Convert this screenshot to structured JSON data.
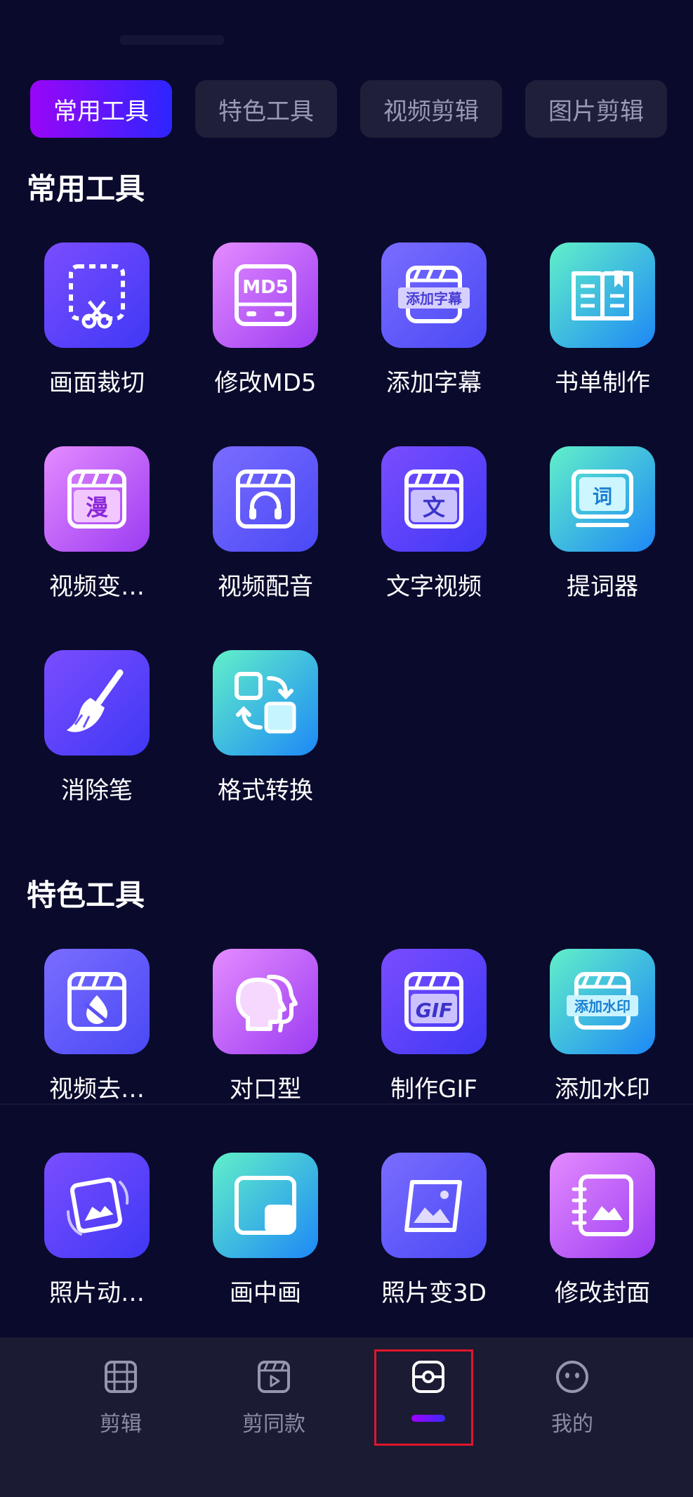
{
  "tabs": [
    {
      "label": "常用工具",
      "active": true
    },
    {
      "label": "特色工具",
      "active": false
    },
    {
      "label": "视频剪辑",
      "active": false
    },
    {
      "label": "图片剪辑",
      "active": false
    }
  ],
  "sections": {
    "common_title": "常用工具",
    "special_title": "特色工具"
  },
  "common_tools": [
    {
      "label": "画面裁切",
      "icon": "crop-scissors-icon"
    },
    {
      "label": "修改MD5",
      "icon": "md5-icon",
      "icon_text": "MD5"
    },
    {
      "label": "添加字幕",
      "icon": "subtitle-clapper-icon",
      "icon_text": "添加字幕"
    },
    {
      "label": "书单制作",
      "icon": "book-icon"
    },
    {
      "label": "视频变…",
      "icon": "comic-clapper-icon",
      "icon_text": "漫"
    },
    {
      "label": "视频配音",
      "icon": "dubbing-clapper-icon"
    },
    {
      "label": "文字视频",
      "icon": "text-clapper-icon",
      "icon_text": "文"
    },
    {
      "label": "提词器",
      "icon": "teleprompter-icon",
      "icon_text": "词"
    },
    {
      "label": "消除笔",
      "icon": "eraser-brush-icon"
    },
    {
      "label": "格式转换",
      "icon": "format-convert-icon"
    }
  ],
  "special_tools": [
    {
      "label": "视频去…",
      "icon": "remove-watermark-clapper-icon"
    },
    {
      "label": "对口型",
      "icon": "lip-sync-faces-icon"
    },
    {
      "label": "制作GIF",
      "icon": "gif-clapper-icon",
      "icon_text": "GIF"
    },
    {
      "label": "添加水印",
      "icon": "watermark-clapper-icon",
      "icon_text": "添加水印"
    },
    {
      "label": "照片动…",
      "icon": "photo-animate-icon"
    },
    {
      "label": "画中画",
      "icon": "picture-in-picture-icon"
    },
    {
      "label": "照片变3D",
      "icon": "photo-3d-icon"
    },
    {
      "label": "修改封面",
      "icon": "cover-notebook-icon"
    }
  ],
  "bottom_nav": [
    {
      "label": "剪辑",
      "icon": "film-icon"
    },
    {
      "label": "剪同款",
      "icon": "clapper-play-icon"
    },
    {
      "label": "",
      "icon": "toolbox-icon",
      "active": true
    },
    {
      "label": "我的",
      "icon": "smiley-face-icon"
    }
  ],
  "colors": {
    "background": "#0a0a2c",
    "accent_start": "#9a06f7",
    "accent_end": "#2c25ff",
    "highlight": "#e0162b"
  }
}
